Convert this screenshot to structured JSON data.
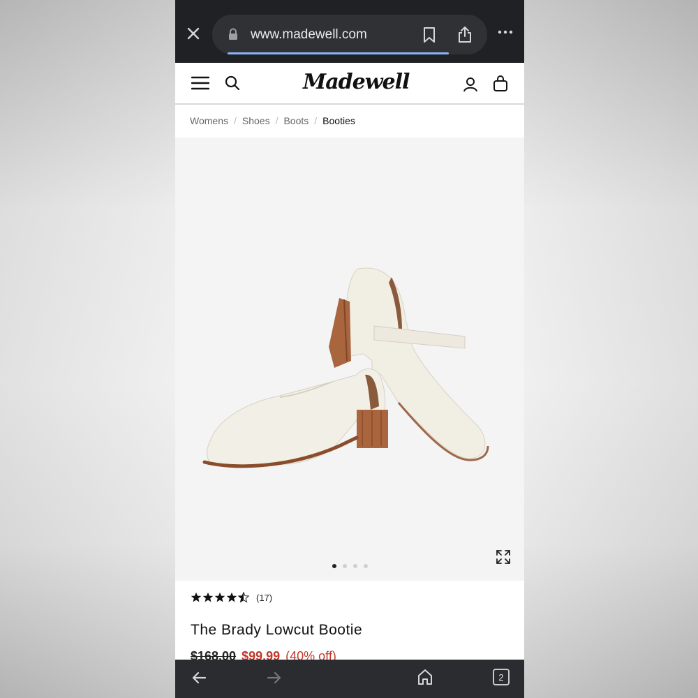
{
  "browser": {
    "url": "www.madewell.com",
    "tab_count": "2",
    "progress": 0.86
  },
  "site": {
    "logo_text": "Madewell"
  },
  "breadcrumb": {
    "items": [
      "Womens",
      "Shoes",
      "Boots",
      "Booties"
    ]
  },
  "gallery": {
    "image_count": 4,
    "active_index": 0
  },
  "product": {
    "rating": 4.5,
    "review_count": "(17)",
    "title": "The Brady Lowcut Bootie",
    "price_original": "$168.00",
    "price_sale": "$99.99",
    "discount": "(40% off)"
  },
  "icons": {
    "close": "close-icon",
    "lock": "lock-icon",
    "bookmark": "bookmark-icon",
    "share": "share-icon",
    "more": "more-icon",
    "menu": "menu-icon",
    "search": "search-icon",
    "account": "account-icon",
    "bag": "bag-icon",
    "expand": "expand-icon",
    "back": "back-arrow-icon",
    "forward": "forward-arrow-icon",
    "home": "home-icon"
  },
  "colors": {
    "sale": "#c0392b",
    "browser_bar": "#202124",
    "progress": "#8ab4f8"
  }
}
